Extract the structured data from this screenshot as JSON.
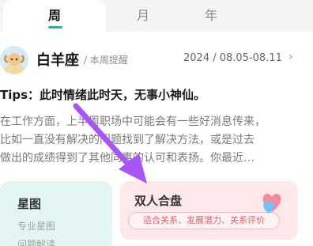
{
  "tabs": [
    {
      "label": "周",
      "active": true
    },
    {
      "label": "月",
      "active": false
    },
    {
      "label": "年",
      "active": false
    }
  ],
  "header": {
    "sign_name": "白羊座",
    "subtitle": "/ 本周提醒",
    "date_range": "2024 / 08.05-08.11",
    "chevron": "›"
  },
  "tips": "Tips：此时情绪此时天，无事小神仙。",
  "body_lines": [
    "在工作方面，上半周职场中可能会有一些好消息传来，",
    "比如一直没有解决的问题找到了解决方法，或是过去",
    "做出的成绩得到了其他同事的认可和表扬。你最近…"
  ],
  "cards": {
    "left": {
      "title": "星图",
      "line1": "专业星图",
      "line2": "问题解读"
    },
    "right": {
      "title": "双人合盘",
      "tags": "适合关系、发展潜力、关系评价"
    }
  },
  "colors": {
    "accent": "#1fb8a8",
    "card_left_bg": "#e3f6f3",
    "card_right_bg": "#fde9ea",
    "pointer": "#a855f7"
  },
  "icons": {
    "avatar": "aries-avatar-icon",
    "chevron": "chevron-right-icon",
    "hearts": "hearts-icon",
    "pointer": "pointer-arrow-icon"
  }
}
